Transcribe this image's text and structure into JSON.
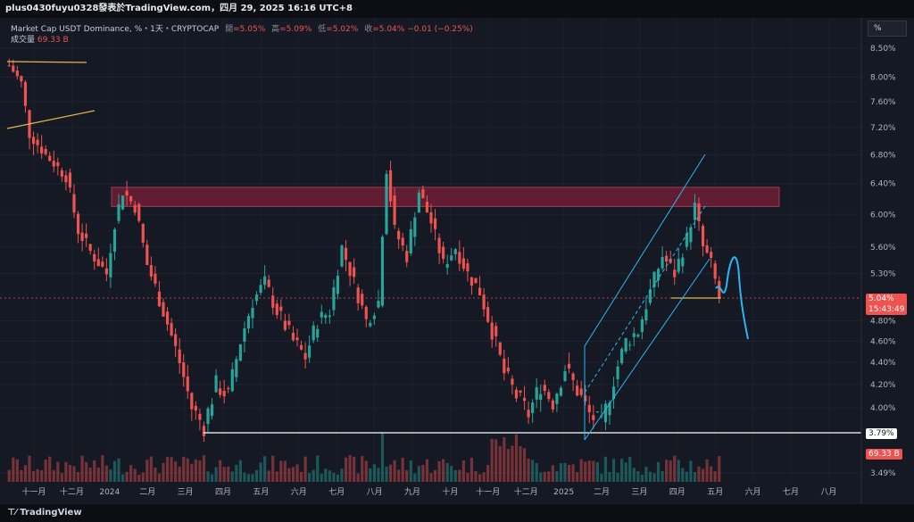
{
  "header": {
    "publisher": "plus0430fuyu0328發表於TradingView.com，四月 29, 2025 16:16 UTC+8"
  },
  "legend": {
    "title": "Market Cap USDT Dominance, %・1天・CRYPTOCAP",
    "open_label": "開",
    "open": "=5.05%",
    "high_label": "高",
    "high": "=5.09%",
    "low_label": "低",
    "low": "=5.02%",
    "close_label": "收",
    "close": "=5.04%",
    "change": "−0.01 (−0.25%)",
    "volume_label": "成交量",
    "volume": "69.33 B"
  },
  "toolbar": {
    "scale_label": "%"
  },
  "footer": {
    "brand": "TradingView"
  },
  "colors": {
    "up": "#26a69a",
    "down": "#ef5350",
    "zone": "#7a1f35",
    "channel": "#29b6f6",
    "trendline": "#e0b84a",
    "support": "#ffffff",
    "projection": "#29b6f6"
  },
  "chart_data": {
    "type": "candlestick",
    "y_scale": "log",
    "y_ticks": [
      "8.50%",
      "8.00%",
      "7.60%",
      "7.20%",
      "6.80%",
      "6.40%",
      "6.00%",
      "5.60%",
      "5.30%",
      "4.80%",
      "4.60%",
      "4.40%",
      "4.20%",
      "4.00%",
      "3.49%"
    ],
    "x_ticks": [
      "十一月",
      "十二月",
      "2024",
      "二月",
      "三月",
      "四月",
      "五月",
      "六月",
      "七月",
      "八月",
      "九月",
      "十月",
      "十一月",
      "十二月",
      "2025",
      "二月",
      "三月",
      "四月",
      "五月",
      "六月",
      "七月",
      "八月"
    ],
    "last_price": "5.04%",
    "countdown": "15:43:49",
    "support_level": "3.79%",
    "volume_label": "69.33 B",
    "resistance_zone": [
      6.1,
      6.35
    ],
    "path_points": [
      [
        0,
        8.2
      ],
      [
        3,
        7.9
      ],
      [
        5,
        7.1
      ],
      [
        9,
        6.8
      ],
      [
        14,
        6.5
      ],
      [
        17,
        5.8
      ],
      [
        20,
        5.55
      ],
      [
        24,
        5.3
      ],
      [
        26,
        5.9
      ],
      [
        28,
        6.3
      ],
      [
        31,
        6.1
      ],
      [
        34,
        5.4
      ],
      [
        38,
        4.9
      ],
      [
        42,
        4.4
      ],
      [
        45,
        4.0
      ],
      [
        48,
        3.85
      ],
      [
        51,
        4.2
      ],
      [
        54,
        4.1
      ],
      [
        57,
        4.6
      ],
      [
        60,
        5.0
      ],
      [
        63,
        5.2
      ],
      [
        66,
        4.9
      ],
      [
        70,
        4.6
      ],
      [
        73,
        4.45
      ],
      [
        76,
        4.8
      ],
      [
        79,
        4.9
      ],
      [
        82,
        5.6
      ],
      [
        85,
        5.2
      ],
      [
        88,
        4.8
      ],
      [
        91,
        5.0
      ],
      [
        93,
        6.6
      ],
      [
        95,
        5.8
      ],
      [
        98,
        5.5
      ],
      [
        101,
        6.3
      ],
      [
        104,
        5.9
      ],
      [
        107,
        5.4
      ],
      [
        110,
        5.6
      ],
      [
        113,
        5.3
      ],
      [
        116,
        5.1
      ],
      [
        119,
        4.7
      ],
      [
        122,
        4.3
      ],
      [
        125,
        4.1
      ],
      [
        128,
        3.95
      ],
      [
        131,
        4.2
      ],
      [
        134,
        4.05
      ],
      [
        137,
        4.35
      ],
      [
        140,
        4.15
      ],
      [
        143,
        3.95
      ],
      [
        146,
        3.85
      ],
      [
        149,
        4.25
      ],
      [
        152,
        4.6
      ],
      [
        155,
        4.7
      ],
      [
        158,
        5.1
      ],
      [
        161,
        5.5
      ],
      [
        164,
        5.3
      ],
      [
        167,
        5.7
      ],
      [
        169,
        6.1
      ],
      [
        171,
        5.6
      ],
      [
        173,
        5.4
      ],
      [
        175,
        5.04
      ]
    ],
    "candles": 176
  }
}
